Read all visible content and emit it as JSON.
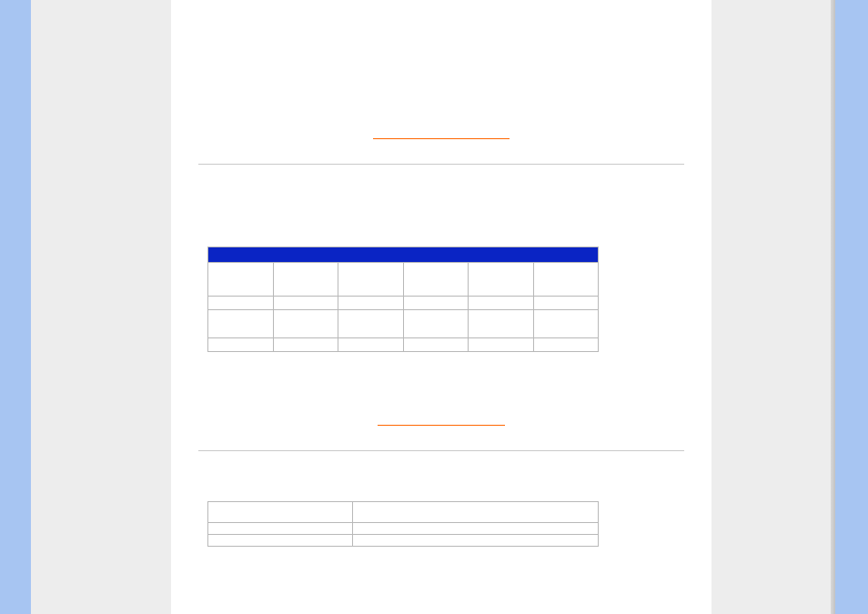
{
  "section1": {
    "link_label": "",
    "table": {
      "header_columns": [
        "",
        "",
        "",
        "",
        "",
        ""
      ],
      "rows": [
        [
          "",
          "",
          "",
          "",
          "",
          ""
        ],
        [
          "",
          "",
          "",
          "",
          "",
          ""
        ],
        [
          "",
          "",
          "",
          "",
          "",
          ""
        ],
        [
          "",
          "",
          "",
          "",
          "",
          ""
        ]
      ]
    }
  },
  "section2": {
    "link_label": "",
    "table": {
      "rows": [
        [
          "",
          ""
        ],
        [
          "",
          ""
        ],
        [
          "",
          ""
        ]
      ]
    }
  }
}
